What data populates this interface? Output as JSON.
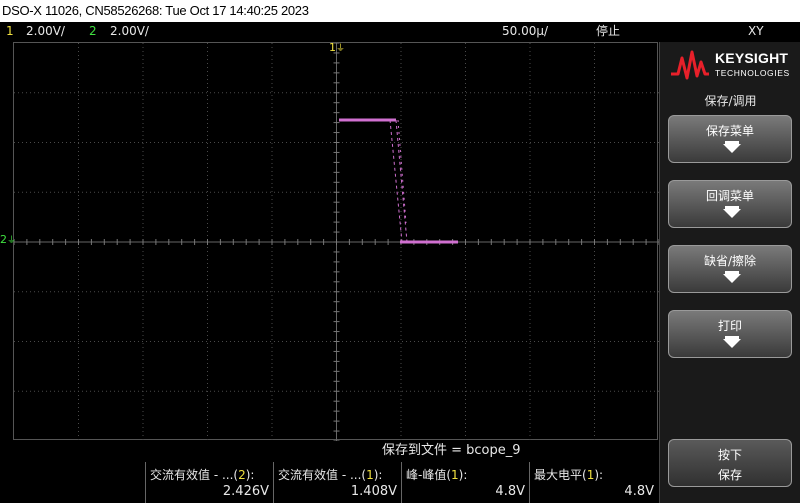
{
  "title": "DSO-X 11026, CN58526268: Tue Oct 17 14:40:25 2023",
  "status": {
    "ch1_num": "1",
    "ch1_scale": "2.00V/",
    "ch2_num": "2",
    "ch2_scale": "2.00V/",
    "timebase": "50.00µ/",
    "run_state": "停止",
    "mode": "XY"
  },
  "markers": {
    "ch1": "1",
    "ch2": "2"
  },
  "save_message": "保存到文件 = bcope_9",
  "measurements": [
    {
      "label_pre": "交流有效值 - ...(",
      "channel": "2",
      "label_post": "):",
      "value": "2.426V"
    },
    {
      "label_pre": "交流有效值 - ...(",
      "channel": "1",
      "label_post": "):",
      "value": "1.408V"
    },
    {
      "label_pre": "峰-峰值(",
      "channel": "1",
      "label_post": "):",
      "value": "4.8V"
    },
    {
      "label_pre": "最大电平(",
      "channel": "1",
      "label_post": "):",
      "value": "4.8V"
    }
  ],
  "sidebar": {
    "brand": "KEYSIGHT",
    "brand_sub": "TECHNOLOGIES",
    "menu_title": "保存/调用",
    "softkeys": [
      {
        "label": "保存菜单"
      },
      {
        "label": "回调菜单"
      },
      {
        "label": "缺省/擦除"
      },
      {
        "label": "打印"
      }
    ],
    "press_label_1": "按下",
    "press_label_2": "保存"
  },
  "colors": {
    "ch1": "#f0e040",
    "ch2": "#40e040",
    "trace": "#d070d0",
    "grid": "#4a4a4a"
  }
}
